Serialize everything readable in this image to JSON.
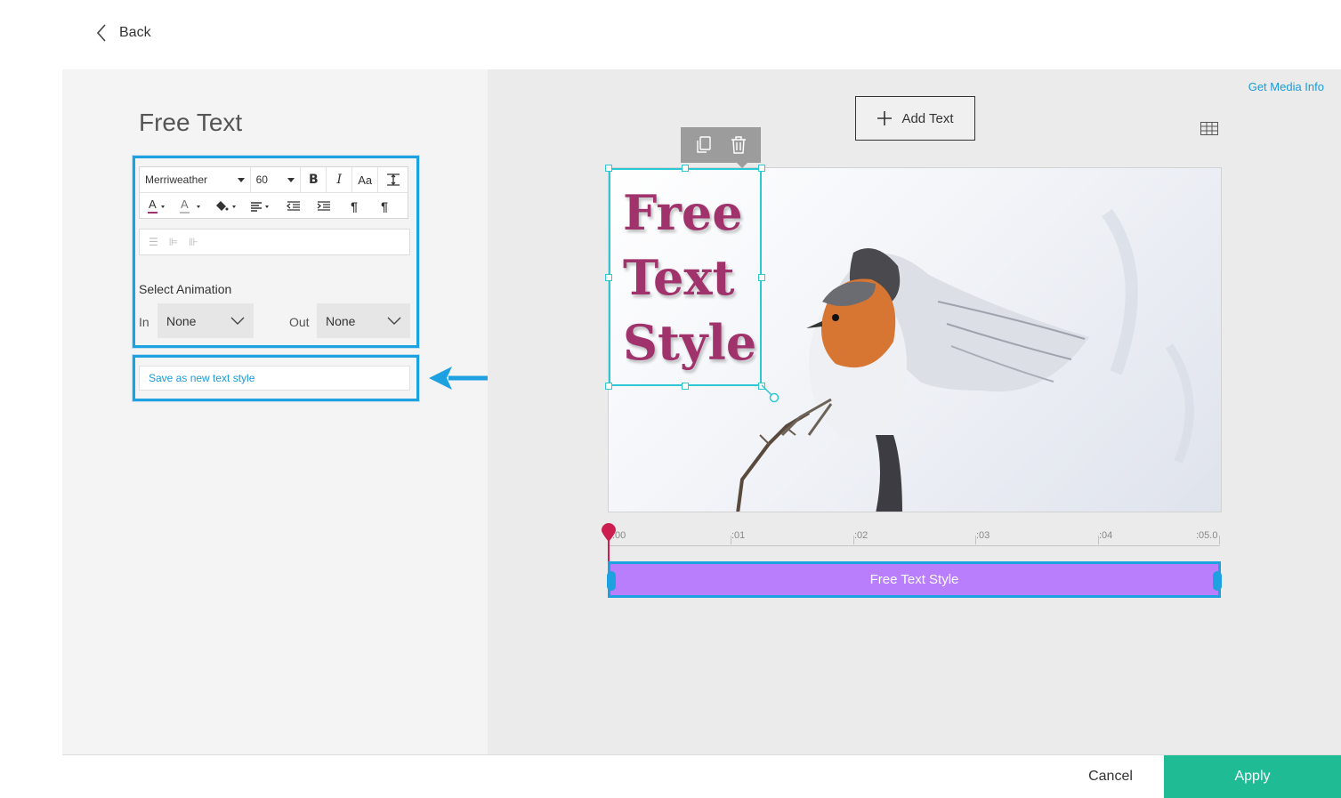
{
  "header": {
    "back_label": "Back"
  },
  "editor": {
    "title": "Free Text",
    "font_family": "Merriweather",
    "font_size": "60",
    "animation": {
      "section_label": "Select Animation",
      "in_label": "In",
      "in_value": "None",
      "out_label": "Out",
      "out_value": "None"
    },
    "save_style_label": "Save as new text style"
  },
  "preview": {
    "media_info_label": "Get Media Info",
    "add_text_label": "Add Text",
    "overlay_text_lines": [
      "Free",
      "Text",
      "Style"
    ]
  },
  "timeline": {
    "ticks": [
      ":00",
      ":01",
      ":02",
      ":03",
      ":04",
      ":05.0"
    ],
    "track_label": "Free Text Style"
  },
  "footer": {
    "cancel_label": "Cancel",
    "apply_label": "Apply"
  },
  "colors": {
    "accent": "#1ea1e0",
    "text_color": "#a0326c",
    "track": "#b87efc",
    "apply": "#1fbb94",
    "playhead": "#cc1f4f"
  }
}
